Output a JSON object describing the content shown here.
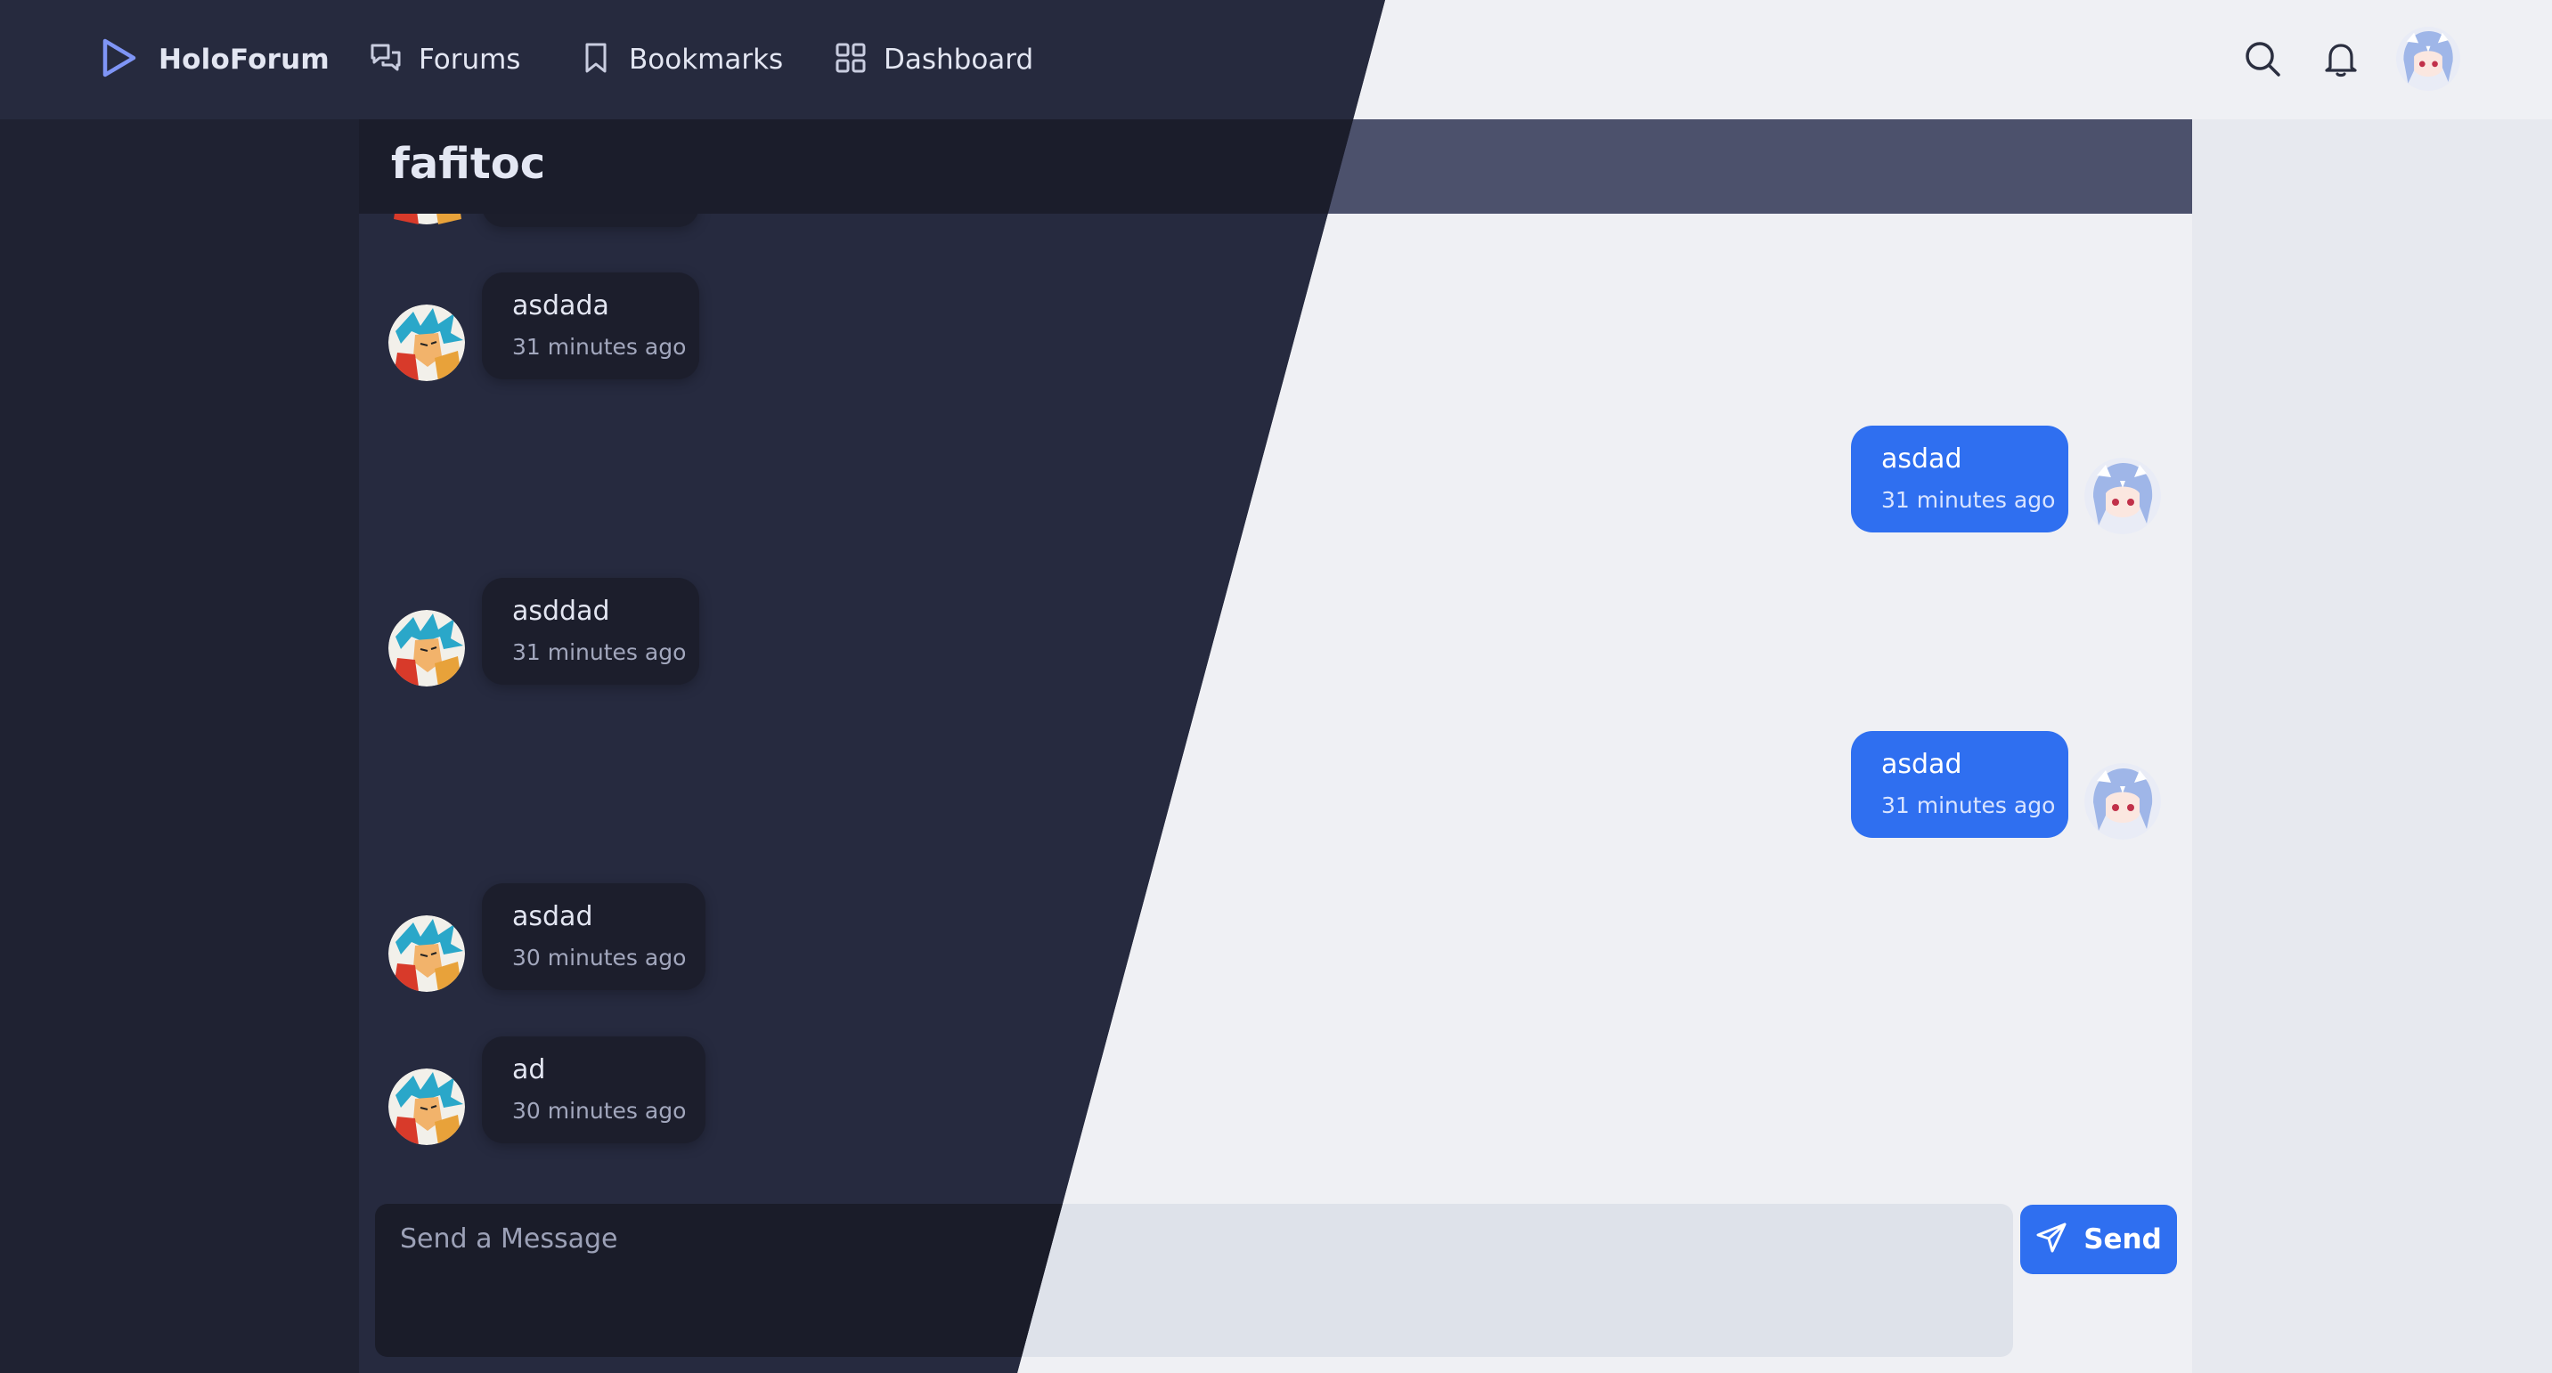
{
  "header": {
    "brand": "HoloForum",
    "nav": [
      {
        "label": "Forums",
        "icon": "chat-bubbles-icon"
      },
      {
        "label": "Bookmarks",
        "icon": "bookmark-icon"
      },
      {
        "label": "Dashboard",
        "icon": "grid-icon"
      }
    ],
    "actions": [
      "search-icon",
      "bell-icon",
      "user-avatar"
    ]
  },
  "chat": {
    "title": "fafitoc",
    "messages": [
      {
        "side": "other",
        "text": "asdada",
        "time": "31 minutes ago"
      },
      {
        "side": "self",
        "text": "asdad",
        "time": "31 minutes ago"
      },
      {
        "side": "other",
        "text": "asddad",
        "time": "31 minutes ago"
      },
      {
        "side": "self",
        "text": "asdad",
        "time": "31 minutes ago"
      },
      {
        "side": "other",
        "text": "asdad",
        "time": "30 minutes ago"
      },
      {
        "side": "other",
        "text": "ad",
        "time": "30 minutes ago"
      }
    ]
  },
  "composer": {
    "placeholder": "Send a Message",
    "send_label": "Send"
  },
  "colors": {
    "accent": "#2f6ff0",
    "dark_bg": "#262a3f",
    "light_bg": "#eff0f4",
    "title_bar_light": "#4c516c"
  }
}
